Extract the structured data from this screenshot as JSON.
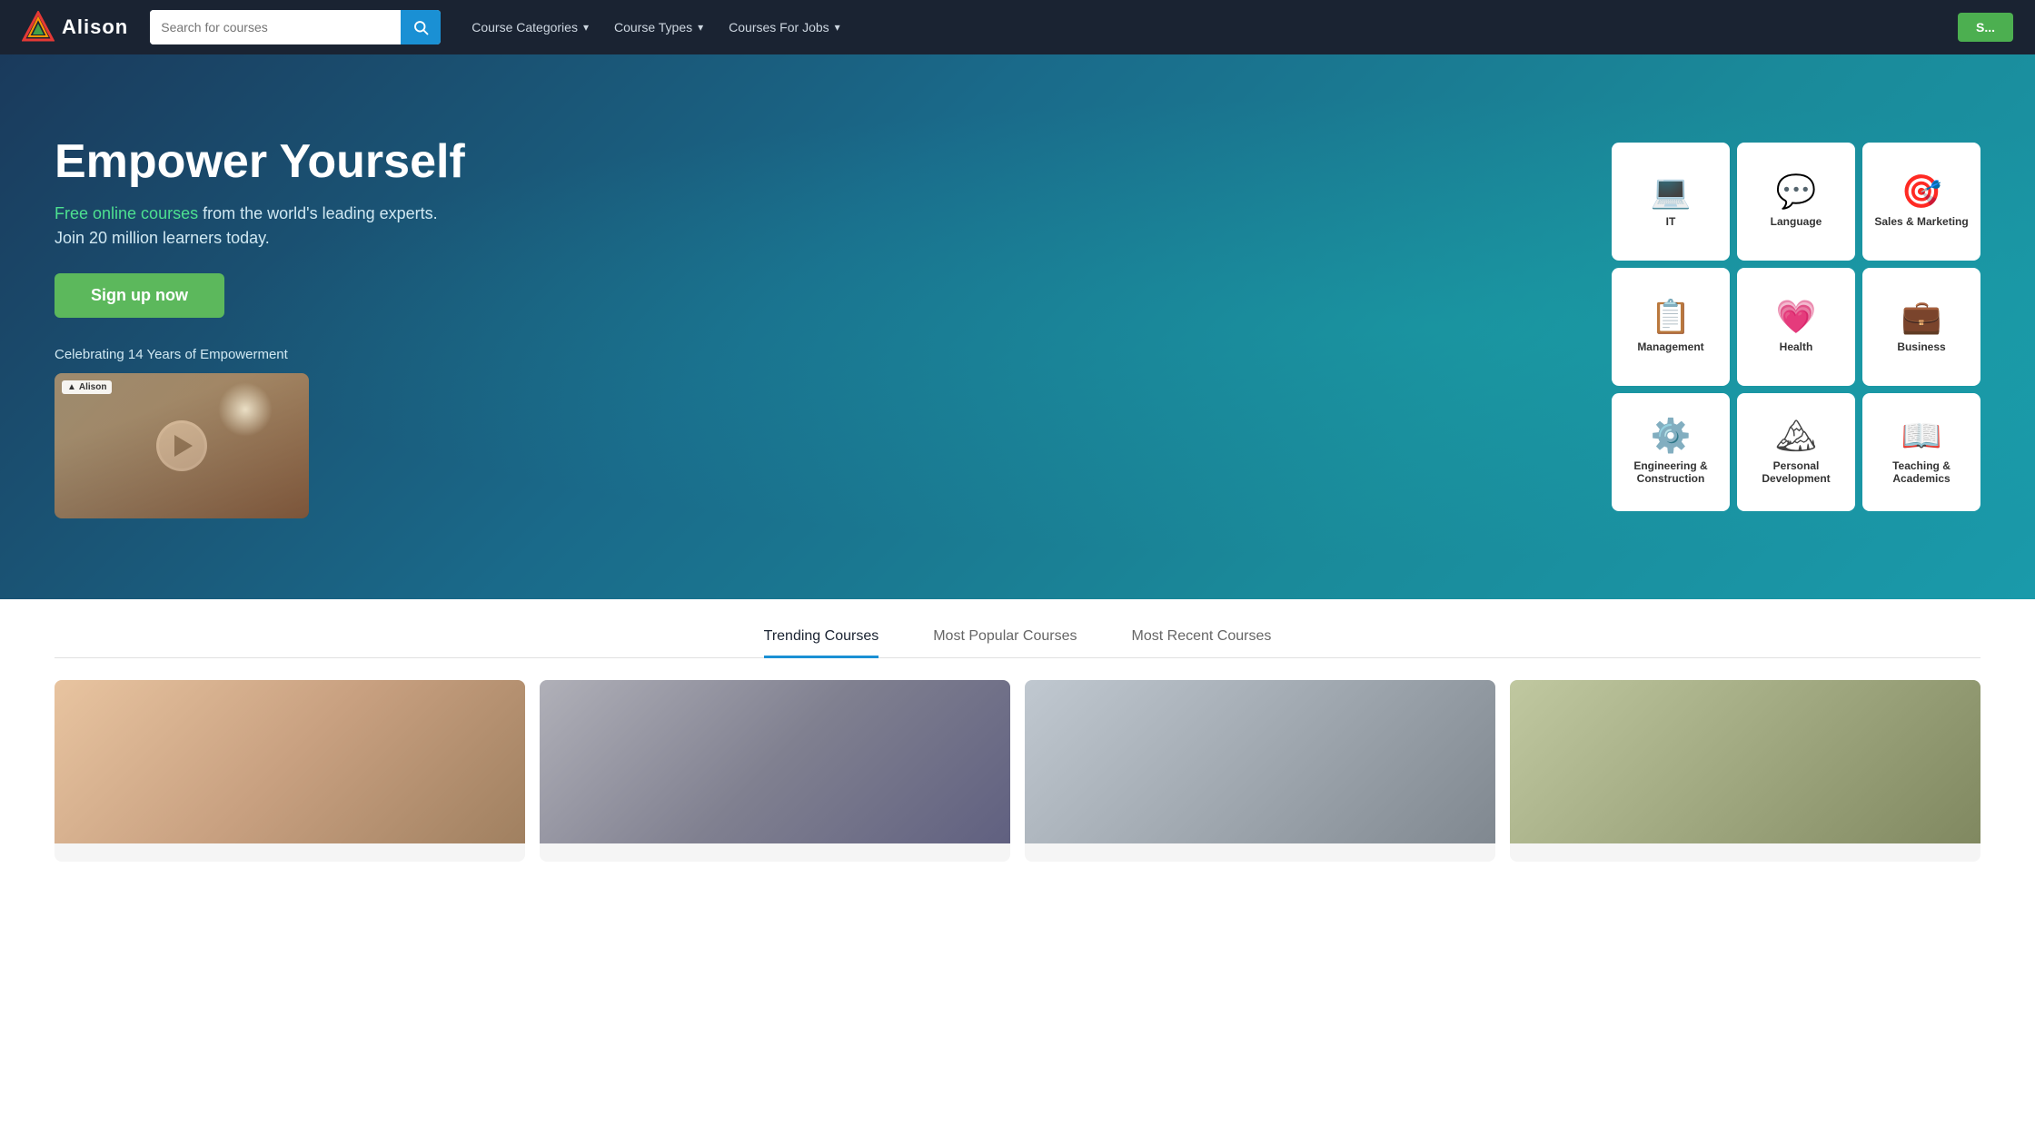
{
  "nav": {
    "logo_text": "Alison",
    "search_placeholder": "Search for courses",
    "search_btn_icon": "search",
    "links": [
      {
        "label": "Course Categories",
        "id": "course-categories"
      },
      {
        "label": "Course Types",
        "id": "course-types"
      },
      {
        "label": "Courses For Jobs",
        "id": "courses-for-jobs"
      }
    ],
    "signup_label": "S..."
  },
  "hero": {
    "title": "Empower Yourself",
    "subtitle_highlight": "Free online courses",
    "subtitle_rest": " from the world's leading experts.",
    "sub2": "Join 20 million learners today.",
    "signup_btn": "Sign up now",
    "celebrating": "Celebrating 14 Years of Empowerment",
    "video_brand": "Alison",
    "video_brand_icon": "▲"
  },
  "categories": [
    {
      "id": "it",
      "label": "IT",
      "icon": "💻"
    },
    {
      "id": "language",
      "label": "Language",
      "icon": "💬"
    },
    {
      "id": "sales-marketing",
      "label": "Sales & Marketing",
      "icon": "🎯"
    },
    {
      "id": "management",
      "label": "Management",
      "icon": "📋"
    },
    {
      "id": "health",
      "label": "Health",
      "icon": "💗"
    },
    {
      "id": "business",
      "label": "Business",
      "icon": "💼"
    },
    {
      "id": "engineering",
      "label": "Engineering & Construction",
      "icon": "⚙️"
    },
    {
      "id": "personal-development",
      "label": "Personal Development",
      "icon": "🏔"
    },
    {
      "id": "teaching-academics",
      "label": "Teaching & Academics",
      "icon": "📖"
    }
  ],
  "tabs": [
    {
      "label": "Trending Courses",
      "active": true
    },
    {
      "label": "Most Popular Courses",
      "active": false
    },
    {
      "label": "Most Recent Courses",
      "active": false
    }
  ],
  "courses": [
    {
      "id": "course-1",
      "img_class": "course-img-1"
    },
    {
      "id": "course-2",
      "img_class": "course-img-2"
    },
    {
      "id": "course-3",
      "img_class": "course-img-3"
    },
    {
      "id": "course-4",
      "img_class": "course-img-4"
    },
    {
      "id": "course-5",
      "img_class": "course-img-5"
    }
  ]
}
